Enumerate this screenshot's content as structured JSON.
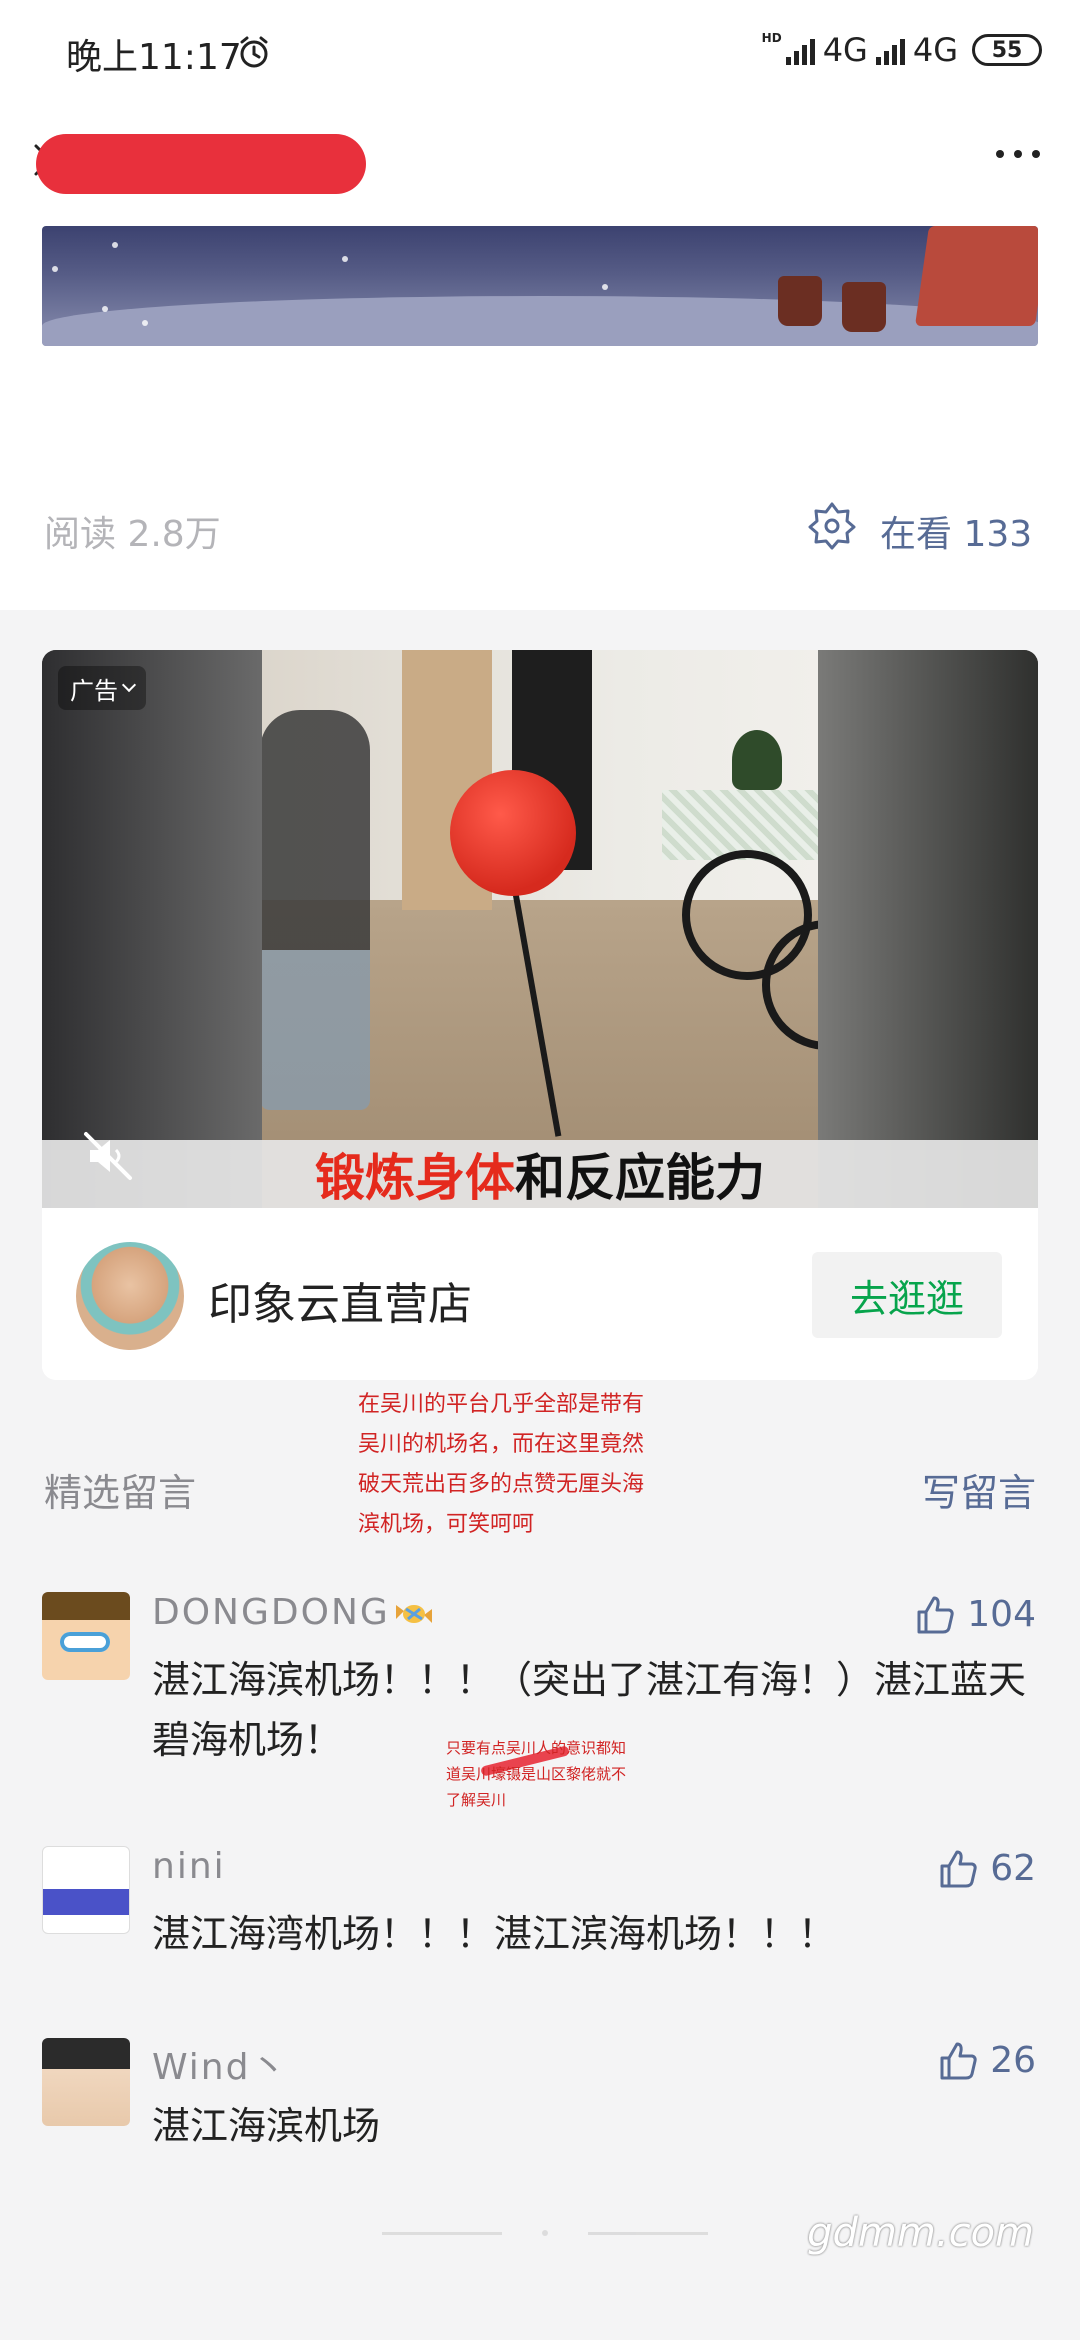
{
  "status_bar": {
    "time": "晚上11:17",
    "network_1": "4G",
    "network_2": "4G",
    "hd": "HD",
    "battery": "55"
  },
  "header": {
    "close_icon": "close-icon",
    "more_icon": "more-icon"
  },
  "article": {
    "read_count": "阅读 2.8万",
    "looking_label": "在看 133"
  },
  "ad": {
    "badge": "广告",
    "caption_highlight": "锻炼身体",
    "caption_rest": "和反应能力",
    "store_name": "印象云直营店",
    "store_button": "去逛逛"
  },
  "annotations": {
    "main_note": "在吴川的平台几乎全部是带有吴川的机场名，而在这里竟然破天荒出百多的点赞无厘头海滨机场，可笑呵呵",
    "small_note": "只要有点吴川人的意识都知道吴川壕镊是山区黎佬就不了解吴川"
  },
  "comments": {
    "title": "精选留言",
    "write": "写留言",
    "items": [
      {
        "name": "DONGDONG",
        "text": "湛江海滨机场！！！（突出了湛江有海！）湛江蓝天碧海机场！",
        "likes": "104"
      },
      {
        "name": "nini",
        "text": "湛江海湾机场！！！湛江滨海机场！！！",
        "likes": "62"
      },
      {
        "name": "Wind丶",
        "text": "湛江海滨机场",
        "likes": "26"
      }
    ]
  },
  "watermark": "gdmm.com",
  "colors": {
    "link_blue": "#576b95",
    "green": "#07a44c",
    "annotation_red": "#d12424"
  }
}
